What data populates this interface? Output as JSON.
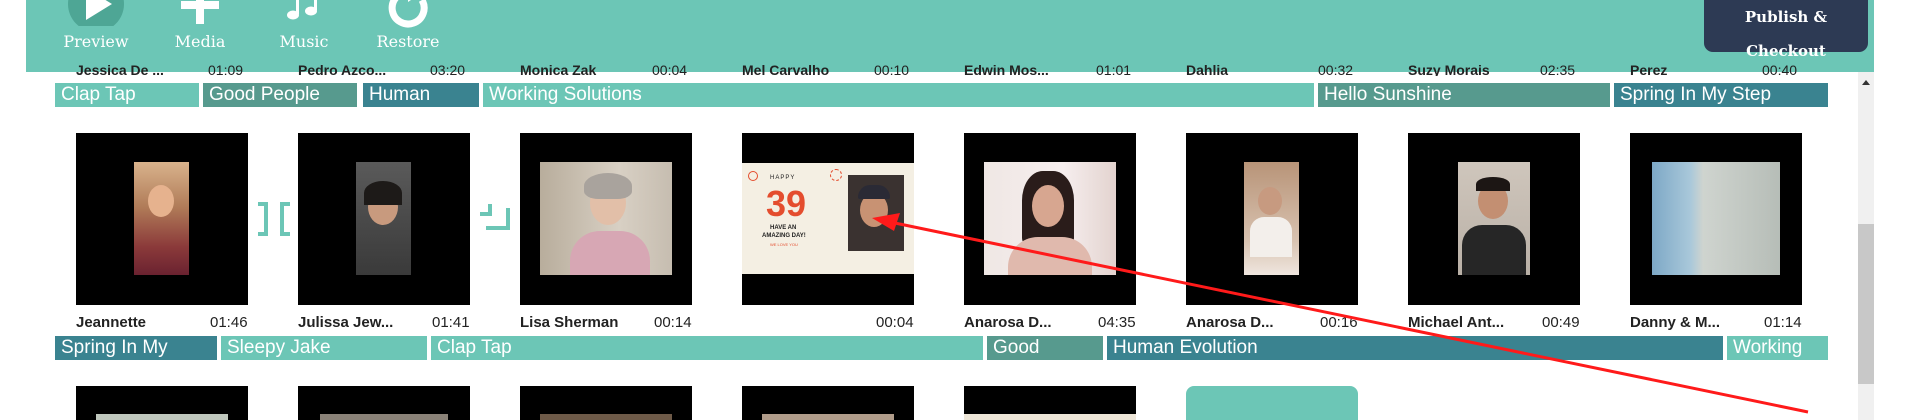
{
  "toolbar": {
    "preview_label": "Preview",
    "media_label": "Media",
    "music_label": "Music",
    "restore_label": "Restore",
    "publish_label": "Publish & Checkout"
  },
  "top_peek": [
    {
      "name": "Jessica De ...",
      "time": "01:09"
    },
    {
      "name": "Pedro Azco...",
      "time": "03:20"
    },
    {
      "name": "Monica Zak",
      "time": "00:04"
    },
    {
      "name": "Mel Carvalho",
      "time": "00:10"
    },
    {
      "name": "Edwin Mos...",
      "time": "01:01"
    },
    {
      "name": "Dahlia",
      "time": "00:32"
    },
    {
      "name": "Suzy Morais",
      "time": "02:35"
    },
    {
      "name": "Perez",
      "time": "00:40"
    }
  ],
  "music_row_1": [
    "Clap Tap",
    "Good People",
    "Human",
    "Working Solutions",
    "Hello Sunshine",
    "Spring In My Step"
  ],
  "clips": [
    {
      "name": "Jeannette",
      "time": "01:46"
    },
    {
      "name": "Julissa Jew...",
      "time": "01:41"
    },
    {
      "name": "Lisa Sherman",
      "time": "00:14"
    },
    {
      "name": "",
      "time": "00:04"
    },
    {
      "name": "Anarosa D...",
      "time": "04:35"
    },
    {
      "name": "Anarosa D...",
      "time": "00:16"
    },
    {
      "name": "Michael Ant...",
      "time": "00:49"
    },
    {
      "name": "Danny & M...",
      "time": "01:14"
    }
  ],
  "birthday_card": {
    "line1": "HAPPY",
    "number": "39",
    "line2": "HAVE AN",
    "line3": "AMAZING DAY!",
    "line4": "WE LOVE YOU"
  },
  "music_row_2": [
    "Spring In My",
    "Sleepy Jake",
    "Clap Tap",
    "Good",
    "Human Evolution",
    "Working"
  ],
  "colors": {
    "header": "#6cc6b6",
    "publish": "#2d3a54",
    "bar_light": "#6cc6b6",
    "bar_gray": "#579a8e",
    "bar_dark": "#3a8390",
    "annotation": "#ff1a1a"
  }
}
